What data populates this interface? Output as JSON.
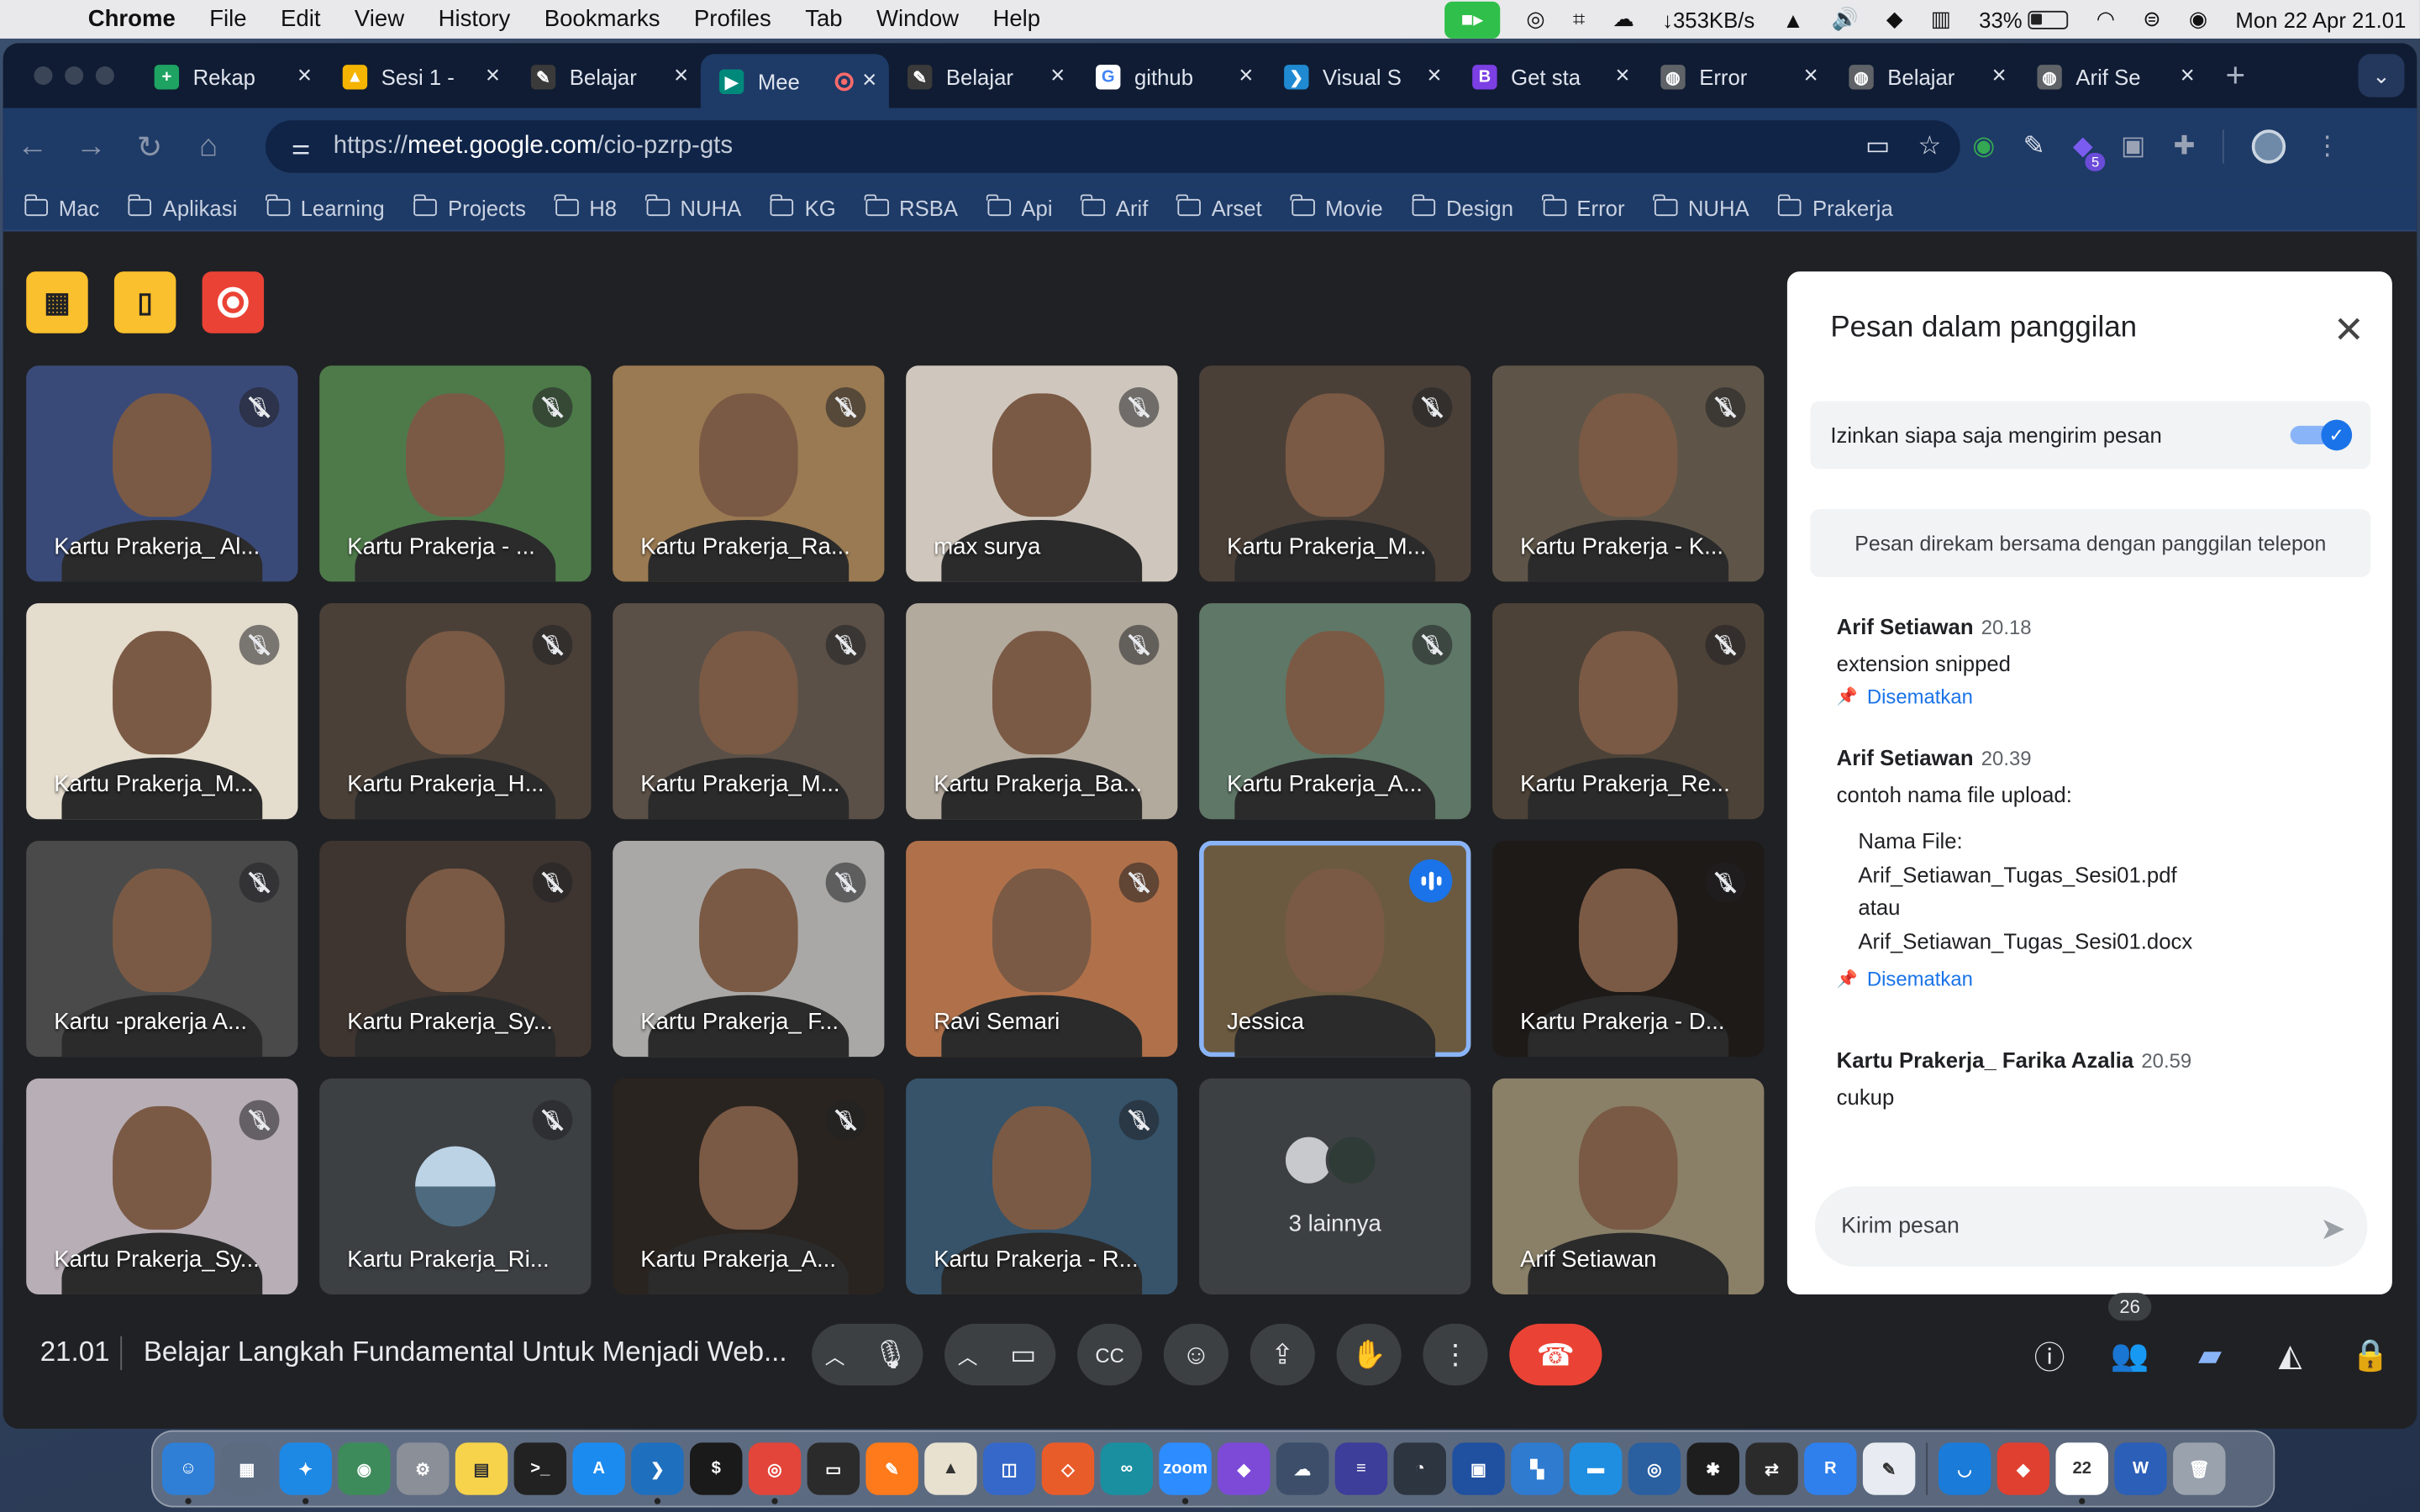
{
  "menubar": {
    "app": "Chrome",
    "items": [
      "File",
      "Edit",
      "View",
      "History",
      "Bookmarks",
      "Profiles",
      "Tab",
      "Window",
      "Help"
    ],
    "net": "↓353KB/s",
    "battery": "33%",
    "clock": "Mon 22 Apr  21.01"
  },
  "tabs": [
    {
      "title": "Rekap",
      "color": "#1ea362",
      "glyph": "+"
    },
    {
      "title": "Sesi 1 -",
      "color": "#f4b400",
      "glyph": "▲"
    },
    {
      "title": "Belajar",
      "color": "#3a3a3a",
      "glyph": "✎"
    },
    {
      "title": "Mee",
      "color": "#00897b",
      "glyph": "▶",
      "active": true
    },
    {
      "title": "Belajar",
      "color": "#3a3a3a",
      "glyph": "✎"
    },
    {
      "title": "github",
      "color": "#ffffff",
      "glyph": "G"
    },
    {
      "title": "Visual S",
      "color": "#1f8ad2",
      "glyph": "❯"
    },
    {
      "title": "Get sta",
      "color": "#7b3fe4",
      "glyph": "B"
    },
    {
      "title": "Error",
      "color": "#5f6368",
      "glyph": "◍"
    },
    {
      "title": "Belajar",
      "color": "#5f6368",
      "glyph": "◍"
    },
    {
      "title": "Arif Se",
      "color": "#5f6368",
      "glyph": "◍"
    }
  ],
  "address": {
    "prefix": "https://",
    "host": "meet.google.com",
    "path": "/cio-pzrp-gts"
  },
  "bookmarks": [
    "Mac",
    "Aplikasi",
    "Learning",
    "Projects",
    "H8",
    "NUHA",
    "KG",
    "RSBA",
    "Api",
    "Arif",
    "Arset",
    "Movie",
    "Design",
    "Error",
    "NUHA",
    "Prakerja"
  ],
  "participants": [
    {
      "name": "Kartu Prakerja_ Al...",
      "bg": "#3a4a78",
      "muted": true
    },
    {
      "name": "Kartu Prakerja - ...",
      "bg": "#4e7a4a",
      "muted": true
    },
    {
      "name": "Kartu Prakerja_Ra...",
      "bg": "#9a7a52",
      "muted": true
    },
    {
      "name": "max surya",
      "bg": "#cfc7bd",
      "muted": true
    },
    {
      "name": "Kartu Prakerja_M...",
      "bg": "#4b4038",
      "muted": true
    },
    {
      "name": "Kartu Prakerja - K...",
      "bg": "#5e5548",
      "muted": true
    },
    {
      "name": "Kartu Prakerja_M...",
      "bg": "#e4dccd",
      "muted": true
    },
    {
      "name": "Kartu Prakerja_H...",
      "bg": "#4a4038",
      "muted": true
    },
    {
      "name": "Kartu Prakerja_M...",
      "bg": "#5a5047",
      "muted": true
    },
    {
      "name": "Kartu Prakerja_Ba...",
      "bg": "#b3aa9e",
      "muted": true
    },
    {
      "name": "Kartu Prakerja_A...",
      "bg": "#5f7766",
      "muted": true
    },
    {
      "name": "Kartu Prakerja_Re...",
      "bg": "#4c4238",
      "muted": true
    },
    {
      "name": "Kartu -prakerja A...",
      "bg": "#4a4a4a",
      "muted": true
    },
    {
      "name": "Kartu Prakerja_Sy...",
      "bg": "#3e3530",
      "muted": true
    },
    {
      "name": "Kartu Prakerja_ F...",
      "bg": "#a9a8a6",
      "muted": true
    },
    {
      "name": "Ravi Semari",
      "bg": "#b0714a",
      "muted": true
    },
    {
      "name": "Jessica",
      "bg": "#6b5a40",
      "muted": false,
      "speaking": true
    },
    {
      "name": "Kartu Prakerja - D...",
      "bg": "#1e1a18",
      "muted": true
    },
    {
      "name": "Kartu Prakerja_Sy...",
      "bg": "#b8aeb6",
      "muted": true
    },
    {
      "name": "Kartu Prakerja_Ri...",
      "bg": "#3c4043",
      "muted": true,
      "avatar": true
    },
    {
      "name": "Kartu Prakerja_A...",
      "bg": "#2a2420",
      "muted": true
    },
    {
      "name": "Kartu Prakerja - R...",
      "bg": "#36536a",
      "muted": true
    },
    {
      "name": "3 lainnya",
      "bg": "#3c4043",
      "muted": false,
      "others": true
    },
    {
      "name": "Arif Setiawan",
      "bg": "#8a8068",
      "muted": false
    }
  ],
  "chat": {
    "title": "Pesan dalam panggilan",
    "permission": "Izinkan siapa saja mengirim pesan",
    "recording_note": "Pesan direkam bersama dengan panggilan telepon",
    "pinned_label": "Disematkan",
    "messages": [
      {
        "sender": "Arif Setiawan",
        "time": "20.18",
        "text": "extension snipped"
      },
      {
        "sender": "Arif Setiawan",
        "time": "20.39",
        "text": "contoh nama file upload:",
        "lines": [
          "Nama File:",
          "Arif_Setiawan_Tugas_Sesi01.pdf",
          "atau",
          "Arif_Setiawan_Tugas_Sesi01.docx"
        ]
      },
      {
        "sender": "Kartu Prakerja_ Farika Azalia",
        "time": "20.59",
        "text": "cukup"
      }
    ],
    "input_placeholder": "Kirim pesan"
  },
  "meeting": {
    "time": "21.01",
    "title": "Belajar Langkah Fundamental Untuk Menjadi Web...",
    "people_count": "26"
  },
  "dock": [
    {
      "c": "#2f7fd6",
      "g": "☺"
    },
    {
      "c": "#5c6b80",
      "g": "▦"
    },
    {
      "c": "#1e88e5",
      "g": "✦"
    },
    {
      "c": "#3d8b5a",
      "g": "◉"
    },
    {
      "c": "#8a8f98",
      "g": "⚙"
    },
    {
      "c": "#f6d34a",
      "g": "▤"
    },
    {
      "c": "#222",
      "g": ">_"
    },
    {
      "c": "#1c8bf0",
      "g": "A"
    },
    {
      "c": "#1f6fbf",
      "g": "❯"
    },
    {
      "c": "#1a1a1a",
      "g": "$"
    },
    {
      "c": "#e3453a",
      "g": "◎"
    },
    {
      "c": "#2b2b2b",
      "g": "▭"
    },
    {
      "c": "#ff7a1a",
      "g": "✎"
    },
    {
      "c": "#e8e1d0",
      "g": "▲"
    },
    {
      "c": "#3568c8",
      "g": "◫"
    },
    {
      "c": "#e85c2a",
      "g": "◇"
    },
    {
      "c": "#1a8fa0",
      "g": "∞"
    },
    {
      "c": "#2d8cff",
      "g": "zoom"
    },
    {
      "c": "#7d4ad8",
      "g": "◆"
    },
    {
      "c": "#3c4e6a",
      "g": "☁"
    },
    {
      "c": "#3d3d9a",
      "g": "≡"
    },
    {
      "c": "#2d3540",
      "g": "◔"
    },
    {
      "c": "#2050a0",
      "g": "▣"
    },
    {
      "c": "#2e7bd0",
      "g": "▚"
    },
    {
      "c": "#1f8ee0",
      "g": "▬"
    },
    {
      "c": "#2a5fa0",
      "g": "◎"
    },
    {
      "c": "#1e1e1e",
      "g": "✱"
    },
    {
      "c": "#2b2b2b",
      "g": "⇄"
    },
    {
      "c": "#2f80ed",
      "g": "R"
    },
    {
      "c": "#e8ecf2",
      "g": "✎"
    },
    {
      "c": "#1a7bd8",
      "g": "◡"
    },
    {
      "c": "#e04030",
      "g": "◆"
    },
    {
      "c": "#ffffff",
      "g": "22"
    },
    {
      "c": "#2b5fb8",
      "g": "W"
    },
    {
      "c": "#9aa3ad",
      "g": "🗑"
    }
  ]
}
